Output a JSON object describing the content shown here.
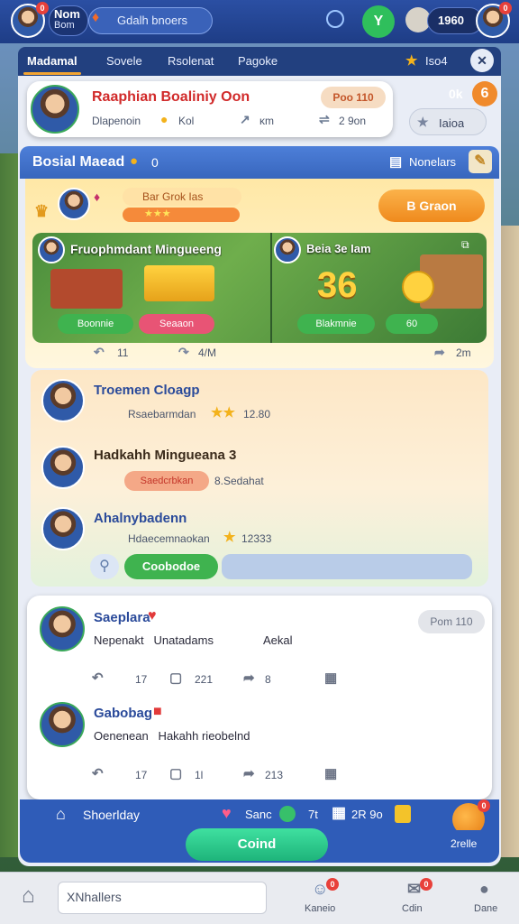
{
  "top_bar": {
    "user_name_line1": "Nom",
    "user_name_line2": "Bom",
    "badge_count": "0",
    "search_text": "Gdalh bnoers",
    "coins": "1960",
    "profile_badge": "0"
  },
  "tabs": [
    {
      "label": "Madamal"
    },
    {
      "label": "Sovele"
    },
    {
      "label": "Rsolenat"
    },
    {
      "label": "Pagoke"
    }
  ],
  "tab_right": {
    "label": "Iso4"
  },
  "profile_card": {
    "name": "Raaphian Boaliniy Oon",
    "subtitle": "Dlapenoin",
    "stat1": "Kol",
    "stat2": "ĸm",
    "stat3": "2 9on",
    "pill": "Poo 110",
    "right_count": "0k",
    "right_badge": "6",
    "right_pill": "Iaioa"
  },
  "social_header": {
    "title": "Bosial Maead",
    "count": "0",
    "right_label": "Nonelars"
  },
  "feature_post": {
    "label_top": "Bar Grok Ias",
    "stars_label": "★★★",
    "green_button": "B Graon",
    "image_left_title": "Fruophmdant Mingueeng",
    "image_right_title": "Beia 3e Iam",
    "score": "36",
    "chip1": "Boonnie",
    "chip2": "Seaaon",
    "chip3": "Blakmnie",
    "chip4": "60",
    "likes": "11",
    "shares": "4/M",
    "right_meta": "2m"
  },
  "leaderboard": [
    {
      "name": "Troemen Cloagp",
      "sub": "Rsaebarmdan",
      "score": "12.80"
    },
    {
      "name": "Hadkahh Mingueana 3",
      "sub": "Saedcrbkan",
      "extra": "8.Sedahat"
    },
    {
      "name": "Ahalnybadenn",
      "sub": "Hdaecemnaokan",
      "score": "12333",
      "button": "Coobodoe"
    }
  ],
  "comments": [
    {
      "name": "Saeplara",
      "text": "Nepenakt   Unatadams",
      "extra": "Aekal",
      "pill": "Pom 110",
      "likes": "17",
      "reposts": "221",
      "shares": "8"
    },
    {
      "name": "Gabobag",
      "text": "Oenenean   Hakahh rieobelnd",
      "likes": "17",
      "reposts": "1l",
      "shares": "213"
    }
  ],
  "bottom_strip": {
    "left": "Shoerlday",
    "mid": "Sanc",
    "count": "7t",
    "right": "2R 9o",
    "fab_label": "2relle",
    "fab_badge": "0"
  },
  "cta": {
    "label": "Coind"
  },
  "bottom_nav": {
    "search_text": "XNhallers",
    "items": [
      {
        "label": "Kaneio",
        "badge": "0"
      },
      {
        "label": "Cdin",
        "badge": "0"
      },
      {
        "label": "Dane"
      }
    ]
  }
}
